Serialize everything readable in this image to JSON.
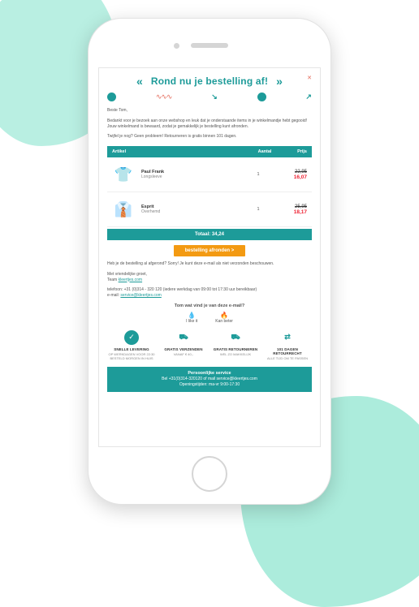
{
  "header": {
    "title": "Rond nu je bestelling af!"
  },
  "greeting": "Beste Tom,",
  "intro": "Bedankt voor je bezoek aan onze webshop en leuk dat je onderstaande items in je winkelmandje hebt gegooid! Jouw winkelmand is bewaard, zodat je gemakkelijk je bestelling kunt afronden.",
  "intro2": "Twijfel je nog? Geen probleem! Retourneren is gratis binnen 101 dagen.",
  "table": {
    "cols": {
      "article": "Artikel",
      "qty": "Aantal",
      "price": "Prijs"
    },
    "items": [
      {
        "brand": "Paul Frank",
        "type": "Longsleeve",
        "qty": "1",
        "old": "22,95",
        "new": "16,07"
      },
      {
        "brand": "Esprit",
        "type": "Overhemd",
        "qty": "1",
        "old": "25,95",
        "new": "18,17"
      }
    ],
    "total_label": "Totaal: 34,24"
  },
  "cta": "bestelling afronden >",
  "afterCta": "Heb je de bestelling al afgerond? Sorry! Je kunt deze e-mail als niet verzonden beschouwen.",
  "signoff": {
    "greet": "Met vriendelijke groet,",
    "team_prefix": "Team ",
    "team_link": "kleertjes.com"
  },
  "contact": {
    "tel": "telefoon: +31 (0)314 - 320 120 (iedere werkdag van 09:00 tot 17:30 uur bereikbaar)",
    "email_prefix": "e-mail: ",
    "email_link": "service@kleertjes.com"
  },
  "feedback": {
    "title": "Tom wat vind je van deze e-mail?",
    "like": "I like it",
    "better": "Kan beter"
  },
  "usps": [
    {
      "title": "SNELLE LEVERING",
      "sub": "OP WERKDAGEN VOOR 22:30 BESTELD MORGEN IN HUIS"
    },
    {
      "title": "GRATIS VERZENDEN",
      "sub": "VANAF € 40,-"
    },
    {
      "title": "GRATIS RETOURNEREN",
      "sub": "WEL ZO MAKKELIJK"
    },
    {
      "title": "101 DAGEN RETOURRECHT",
      "sub": "ALLE TIJD OM TE PASSEN"
    }
  ],
  "footer": {
    "title": "Persoonlijke service",
    "line1": "Bel +31(0)314-320120 of mail service@kleertjes.com",
    "line2": "Openingstijden: ma-vr 9:00-17:30"
  }
}
